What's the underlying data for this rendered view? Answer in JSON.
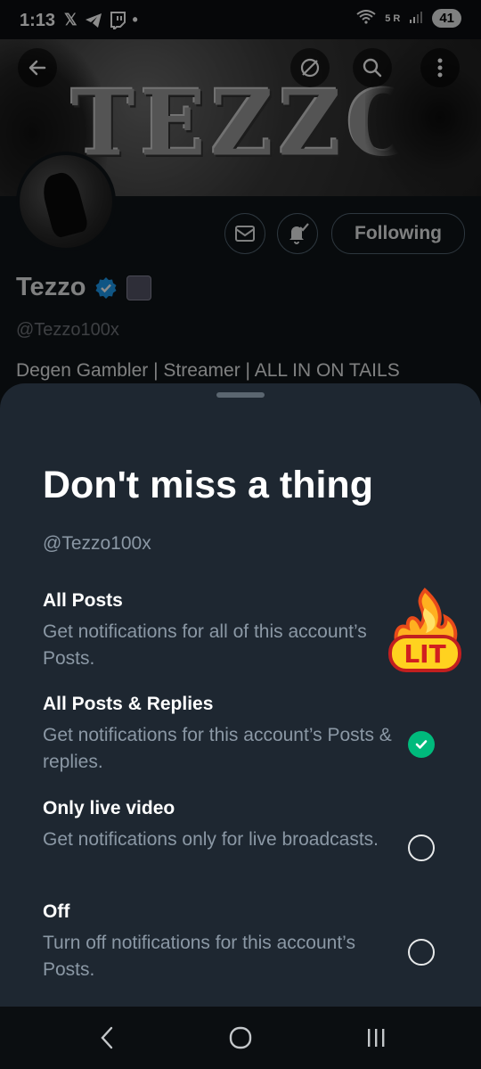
{
  "status_bar": {
    "time": "1:13",
    "battery": "41",
    "signal_label": "5 R"
  },
  "banner": {
    "text": "TEZZO"
  },
  "profile": {
    "name": "Tezzo",
    "handle": "@Tezzo100x",
    "bio": "Degen Gambler | Streamer | ALL IN ON TAILS",
    "following_label": "Following"
  },
  "sheet": {
    "title": "Don't miss a thing",
    "handle": "@Tezzo100x",
    "options": [
      {
        "title": "All Posts",
        "description": "Get notifications for all of this account’s Posts.",
        "selected": false
      },
      {
        "title": "All Posts & Replies",
        "description": "Get notifications for this account’s Posts & replies.",
        "selected": true
      },
      {
        "title": "Only live video",
        "description": "Get notifications only for live broadcasts.",
        "selected": false
      },
      {
        "title": "Off",
        "description": "Turn off notifications for this account’s Posts.",
        "selected": false
      }
    ],
    "sticker_text": "LIT"
  },
  "colors": {
    "accent_green": "#00ba7c",
    "verified_blue": "#1d9bf0",
    "sheet_bg": "#1e2731"
  }
}
